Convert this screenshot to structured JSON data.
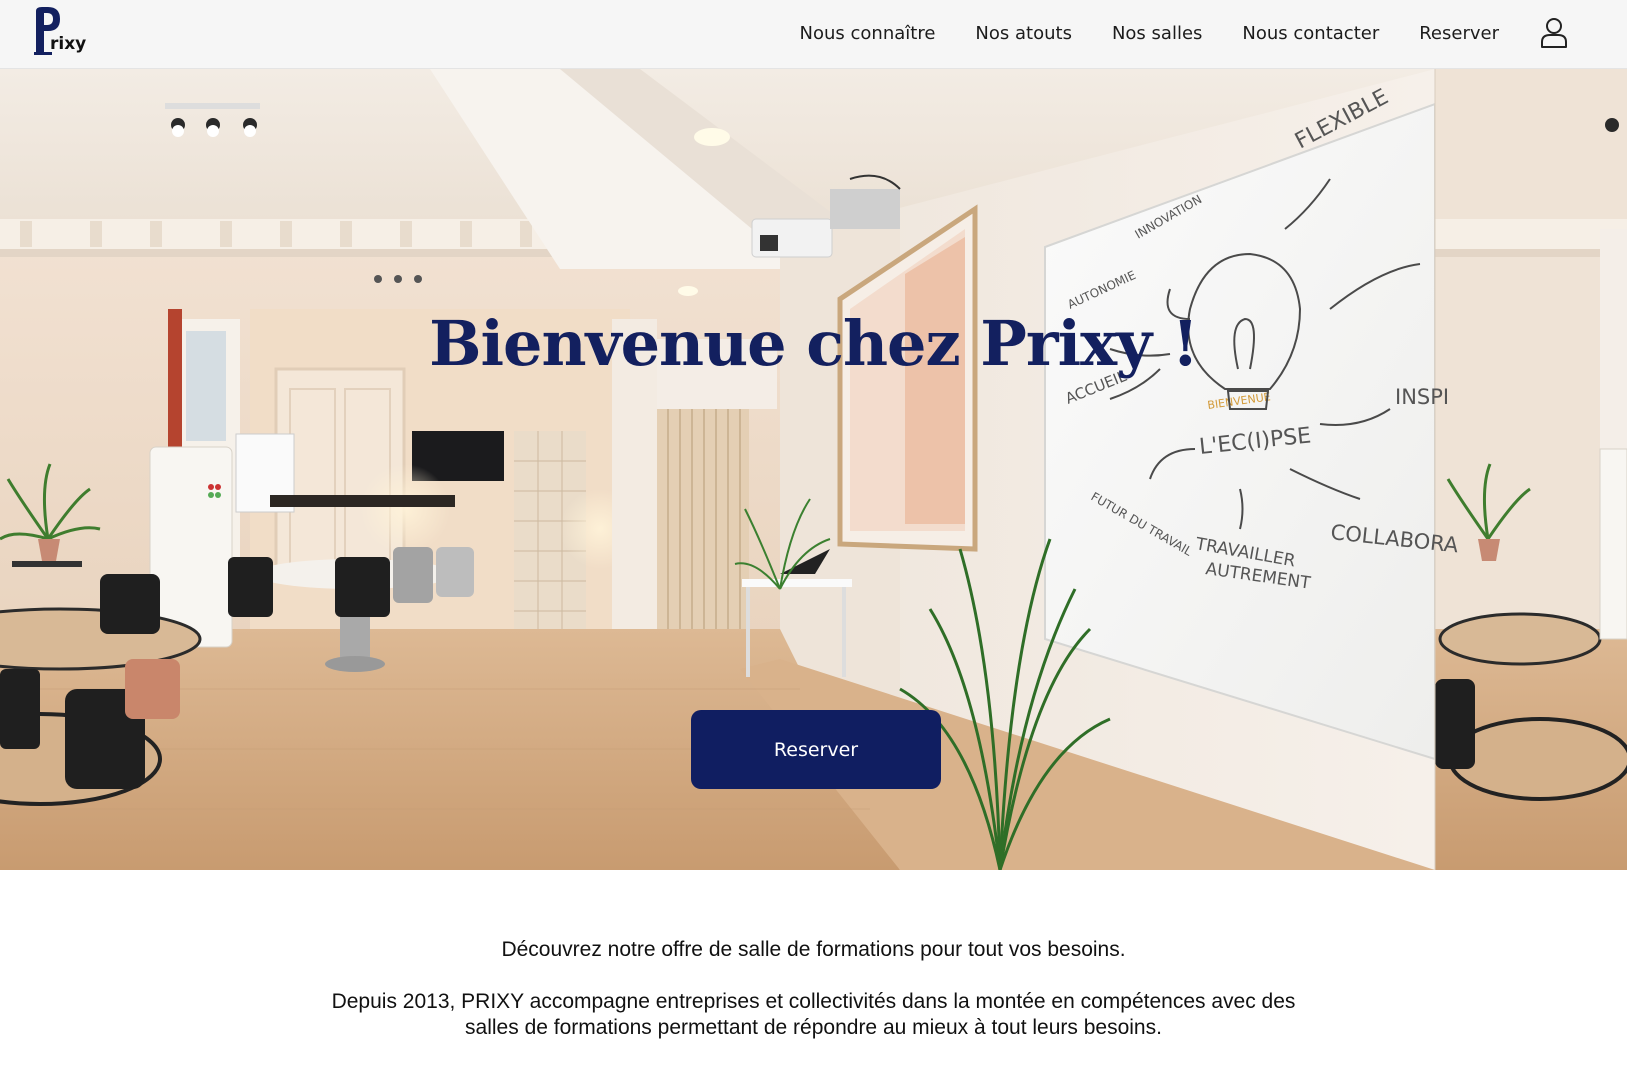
{
  "header": {
    "logo_text": "Prixy",
    "nav": [
      {
        "label": "Nous connaître"
      },
      {
        "label": "Nos atouts"
      },
      {
        "label": "Nos salles"
      },
      {
        "label": "Nous contacter"
      },
      {
        "label": "Reserver"
      }
    ],
    "user_icon": "user-icon"
  },
  "hero": {
    "title": "Bienvenue chez Prixy !",
    "button_label": "Reserver",
    "whiteboard_words": {
      "flexible": "FLEXIBLE",
      "innovation": "INNOVATION",
      "autonomie": "AUTONOMIE",
      "accueil": "ACCUEIL",
      "futur": "FUTUR DU TRAVAIL",
      "travailler": "TRAVAILLER",
      "autrement": "AUTREMENT",
      "collabora": "COLLABORA",
      "inspi": "INSPI",
      "bienvenue": "BIENVENUE",
      "eclipse": "L'EC(I)PSE"
    }
  },
  "intro": {
    "line1": "Découvrez notre offre de salle de formations pour tout vos besoins.",
    "line2": "Depuis 2013, PRIXY accompagne entreprises et collectivités dans la montée en compétences avec des salles de formations permettant de répondre au mieux à tout leurs besoins."
  },
  "colors": {
    "brand_navy": "#101e61",
    "title_navy": "#13205f",
    "header_bg": "#f6f6f6"
  }
}
